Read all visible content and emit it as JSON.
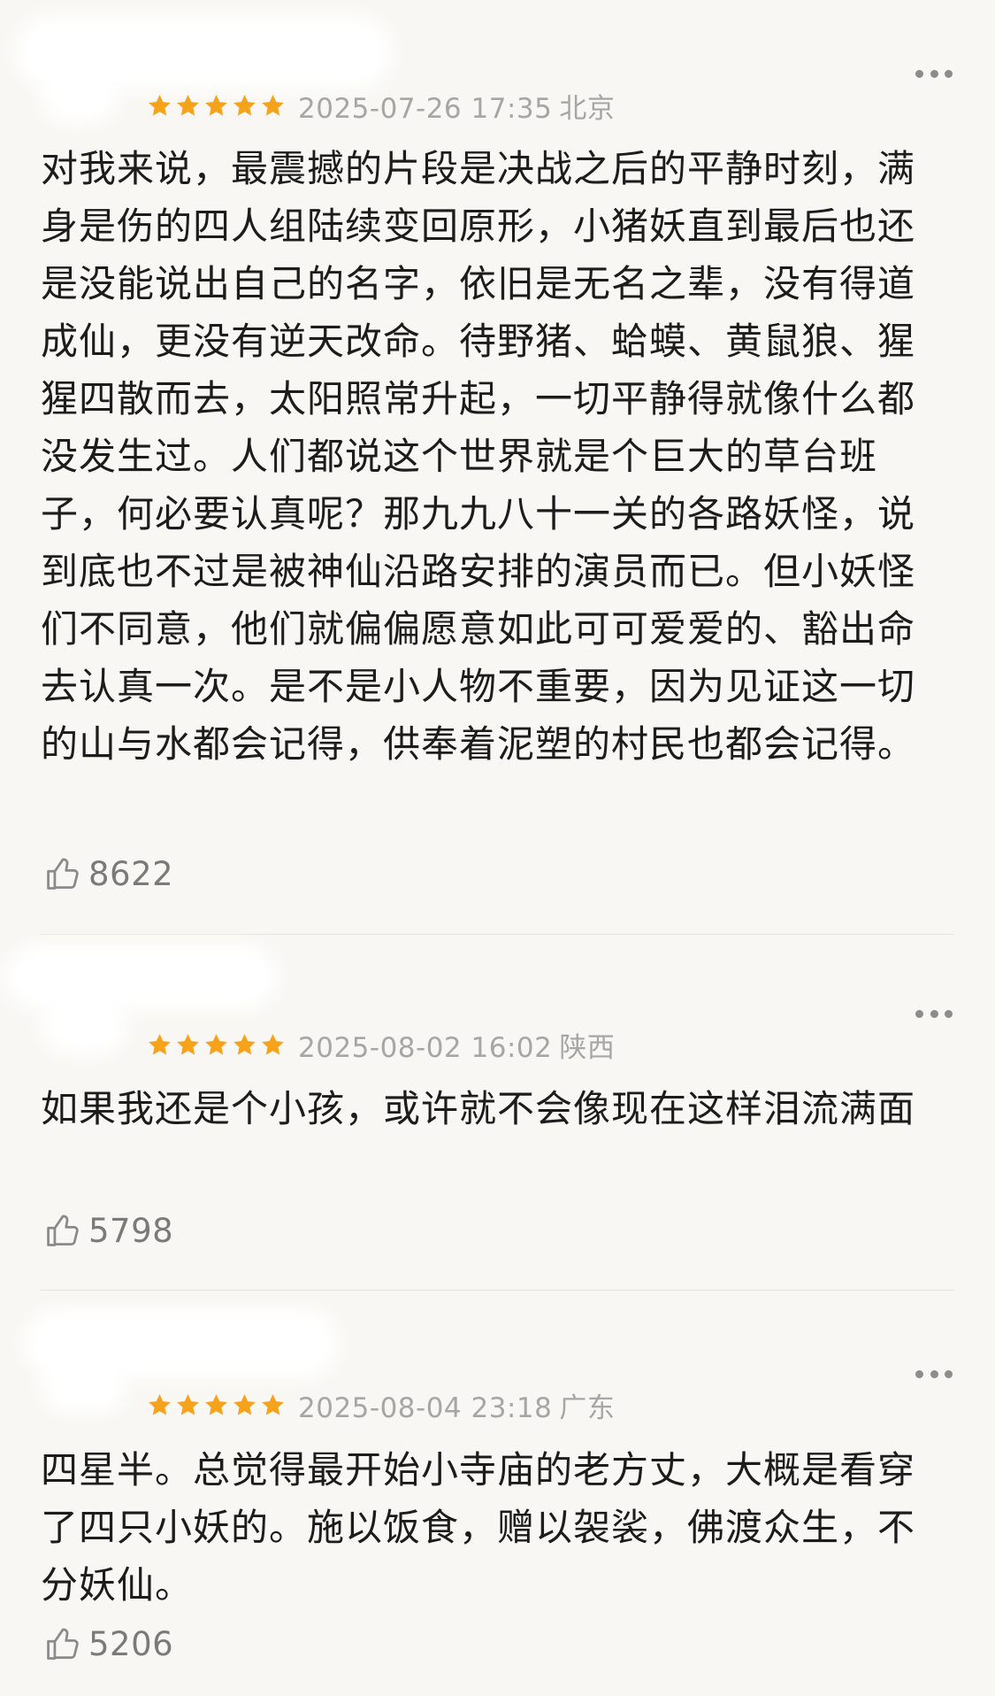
{
  "colors": {
    "star": "#f7a21b",
    "meta_text": "#a6a6a6",
    "body_text": "#1c1c1c",
    "background": "#f8f7f3"
  },
  "reviews": [
    {
      "rating": 5,
      "date": "2025-07-26 17:35",
      "location": "北京",
      "content": "对我来说，最震撼的片段是决战之后的平静时刻，满身是伤的四人组陆续变回原形，小猪妖直到最后也还是没能说出自己的名字，依旧是无名之辈，没有得道成仙，更没有逆天改命。待野猪、蛤蟆、黄鼠狼、猩猩四散而去，太阳照常升起，一切平静得就像什么都没发生过。人们都说这个世界就是个巨大的草台班子，何必要认真呢？那九九八十一关的各路妖怪，说到底也不过是被神仙沿路安排的演员而已。但小妖怪们不同意，他们就偏偏愿意如此可可爱爱的、豁出命去认真一次。是不是小人物不重要，因为见证这一切的山与水都会记得，供奉着泥塑的村民也都会记得。",
      "likes": "8622"
    },
    {
      "rating": 5,
      "date": "2025-08-02 16:02",
      "location": "陕西",
      "content": "如果我还是个小孩，或许就不会像现在这样泪流满面",
      "likes": "5798"
    },
    {
      "rating": 5,
      "date": "2025-08-04 23:18",
      "location": "广东",
      "content": "四星半。总觉得最开始小寺庙的老方丈，大概是看穿了四只小妖的。施以饭食，赠以袈裟，佛渡众生，不分妖仙。",
      "likes": "5206"
    }
  ],
  "icons": {
    "more": "more-dots-icon",
    "like": "thumbs-up-icon",
    "star": "star-icon"
  }
}
